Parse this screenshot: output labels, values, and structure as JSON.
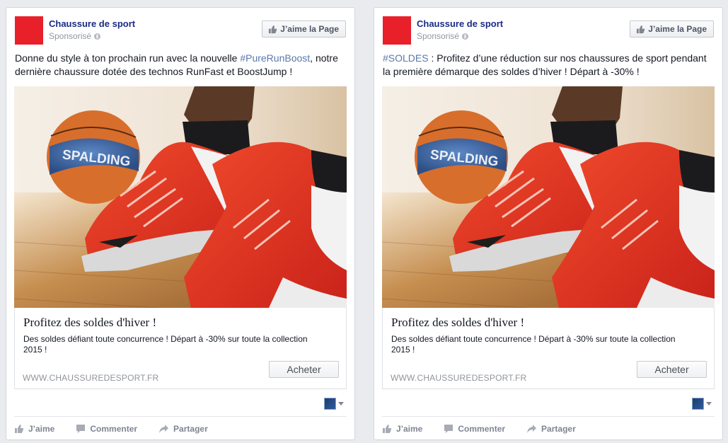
{
  "posts": [
    {
      "page_name": "Chaussure de sport",
      "sponsored_label": "Sponsorisé",
      "like_page_label": "J’aime la Page",
      "message_hashtag": "",
      "message_before": "Donne du style à ton prochain run avec la nouvelle ",
      "message_hashtag_inline": "#PureRunBoost",
      "message_after": ", notre dernière chaussure dotée des technos RunFast et BoostJump !",
      "link_title": "Profitez des soldes d'hiver !",
      "link_description": "Des soldes défiant toute concurrence ! Départ à -30% sur toute la collection 2015 !",
      "link_url": "WWW.CHAUSSUREDESPORT.FR",
      "cta_label": "Acheter",
      "actions": {
        "like": "J’aime",
        "comment": "Commenter",
        "share": "Partager"
      }
    },
    {
      "page_name": "Chaussure de sport",
      "sponsored_label": "Sponsorisé",
      "like_page_label": "J’aime la Page",
      "message_hashtag": "#SOLDES",
      "message_before": " : Profitez d’une réduction sur nos chaussures de sport pendant la première démarque des soldes d’hiver ! Départ à -30% !",
      "message_hashtag_inline": "",
      "message_after": "",
      "link_title": "Profitez des soldes d'hiver !",
      "link_description": "Des soldes défiant toute concurrence ! Départ à -30% sur toute la collection 2015 !",
      "link_url": "WWW.CHAUSSUREDESPORT.FR",
      "cta_label": "Acheter",
      "actions": {
        "like": "J’aime",
        "comment": "Commenter",
        "share": "Partager"
      }
    }
  ],
  "image": {
    "ball_text": "SPALDING"
  },
  "colors": {
    "page_name": "#1b2a86",
    "hashtag": "#5b77ad",
    "avatar": "#e8202a",
    "shoe": "#e8321f"
  }
}
